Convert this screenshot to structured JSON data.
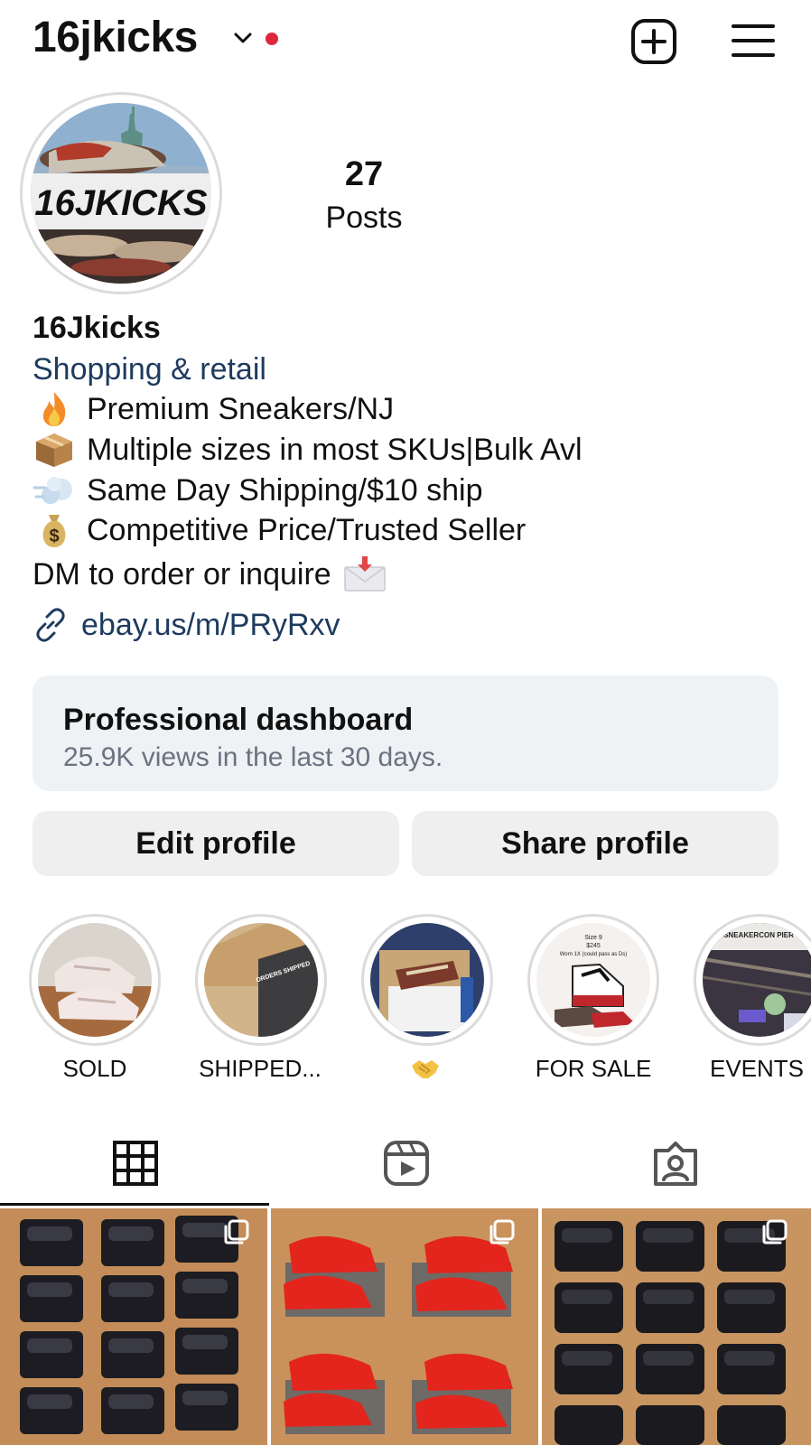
{
  "header": {
    "username": "16jkicks",
    "icons": {
      "chevron": "chevron-down-icon",
      "new_post": "plus-square-icon",
      "menu": "hamburger-menu-icon"
    },
    "notification_dot_color": "#e0263d"
  },
  "profile": {
    "avatar_text": "16JKICKS",
    "posts_count": "27",
    "posts_label": "Posts",
    "full_name": "16Jkicks",
    "category": "Shopping & retail",
    "bio": [
      {
        "emoji": "fire-emoji",
        "text": "Premium Sneakers/NJ"
      },
      {
        "emoji": "package-emoji",
        "text": "Multiple sizes in most SKUs|Bulk Avl"
      },
      {
        "emoji": "dash-emoji",
        "text": "Same Day Shipping/$10 ship"
      },
      {
        "emoji": "money-bag-emoji",
        "text": "Competitive Price/Trusted Seller"
      }
    ],
    "dm_line": "DM to order or inquire",
    "link": "ebay.us/m/PRyRxv"
  },
  "dashboard": {
    "title": "Professional dashboard",
    "subtitle": "25.9K views in the last 30 days."
  },
  "buttons": {
    "edit": "Edit profile",
    "share": "Share profile"
  },
  "highlights": [
    {
      "label": "SOLD"
    },
    {
      "label": "SHIPPED..."
    },
    {
      "label": "",
      "emoji": "handshake-emoji"
    },
    {
      "label": "FOR SALE",
      "overlay_lines": [
        "Size 9",
        "$245",
        "Worn 1X (could pass as Ds)"
      ]
    },
    {
      "label": "EVENTS",
      "overlay_text": "SNEAKERCON PIER"
    }
  ],
  "highlight_overlays": {
    "shipped": "ORDERS SHIPPED"
  },
  "tabs": [
    {
      "icon": "grid-icon",
      "active": true
    },
    {
      "icon": "reels-icon",
      "active": false
    },
    {
      "icon": "tagged-icon",
      "active": false
    }
  ],
  "colors": {
    "link_blue": "#1e3a5f",
    "button_bg": "#efefef",
    "dashboard_bg": "#eff2f5"
  }
}
